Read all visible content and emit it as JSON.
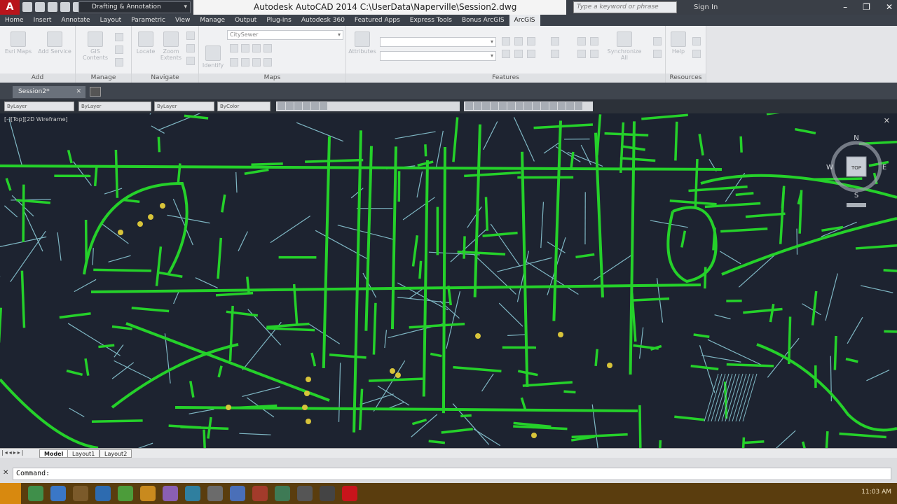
{
  "app": {
    "logo": "A",
    "workspace": "Drafting & Annotation",
    "title": "Autodesk AutoCAD 2014    C:\\UserData\\Naperville\\Session2.dwg",
    "search_placeholder": "Type a keyword or phrase",
    "signin": "Sign In"
  },
  "ribbon_tabs": [
    "Home",
    "Insert",
    "Annotate",
    "Layout",
    "Parametric",
    "View",
    "Manage",
    "Output",
    "Plug-ins",
    "Autodesk 360",
    "Featured Apps",
    "Express Tools",
    "Bonus ArcGIS",
    "ArcGIS"
  ],
  "active_ribbon_tab": "ArcGIS",
  "panels": {
    "add": {
      "title": "Add",
      "buttons": [
        "Esri Maps",
        "Add Service"
      ]
    },
    "manage": {
      "title": "Manage",
      "buttons": [
        "GIS Contents"
      ]
    },
    "navigate": {
      "title": "Navigate",
      "buttons": [
        "Locate",
        "Zoom Extents"
      ]
    },
    "maps": {
      "title": "Maps",
      "identify": "Identify",
      "layer_combo": "CitySewer"
    },
    "features": {
      "title": "Features",
      "attributes": "Attributes",
      "synchronize": "Synchronize All"
    },
    "resources": {
      "title": "Resources",
      "help": "Help"
    }
  },
  "document": {
    "tab": "Session2*"
  },
  "properties": {
    "layer": "ByLayer",
    "linetype": "ByLayer",
    "lineweight": "ByLayer",
    "color": "ByColor"
  },
  "viewport": {
    "label": "[-][Top][2D Wireframe]",
    "compass": {
      "n": "N",
      "s": "S",
      "e": "E",
      "w": "W",
      "cube": "TOP"
    }
  },
  "layout_tabs": [
    "Model",
    "Layout1",
    "Layout2"
  ],
  "active_layout": "Model",
  "command": {
    "prompt": "Command:",
    "value": ""
  },
  "taskbar": {
    "time": "11:03 AM"
  },
  "colors": {
    "sewer": "#25d12a",
    "street": "#7fb7c4",
    "manhole": "#d8c43a",
    "background": "#1d2330"
  }
}
